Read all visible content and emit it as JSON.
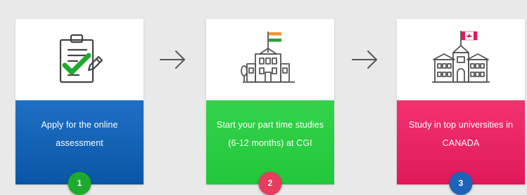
{
  "steps": [
    {
      "text": "Apply for the online assessment",
      "number": "1",
      "icon": "clipboard-check-icon",
      "gradient": [
        "#1f6fc4",
        "#0a56a6"
      ],
      "badge_color": "#1eaa2e"
    },
    {
      "text": "Start your part time studies (6-12 months) at CGI",
      "number": "2",
      "icon": "india-building-icon",
      "gradient": [
        "#34d24b",
        "#22c73b"
      ],
      "badge_color": "#e63c5e"
    },
    {
      "text": "Study in top universities in CANADA",
      "number": "3",
      "icon": "canada-university-icon",
      "gradient": [
        "#f1336e",
        "#e0195a"
      ],
      "badge_color": "#1d63b8"
    }
  ],
  "arrows": [
    "arrow-right-icon",
    "arrow-right-icon"
  ]
}
